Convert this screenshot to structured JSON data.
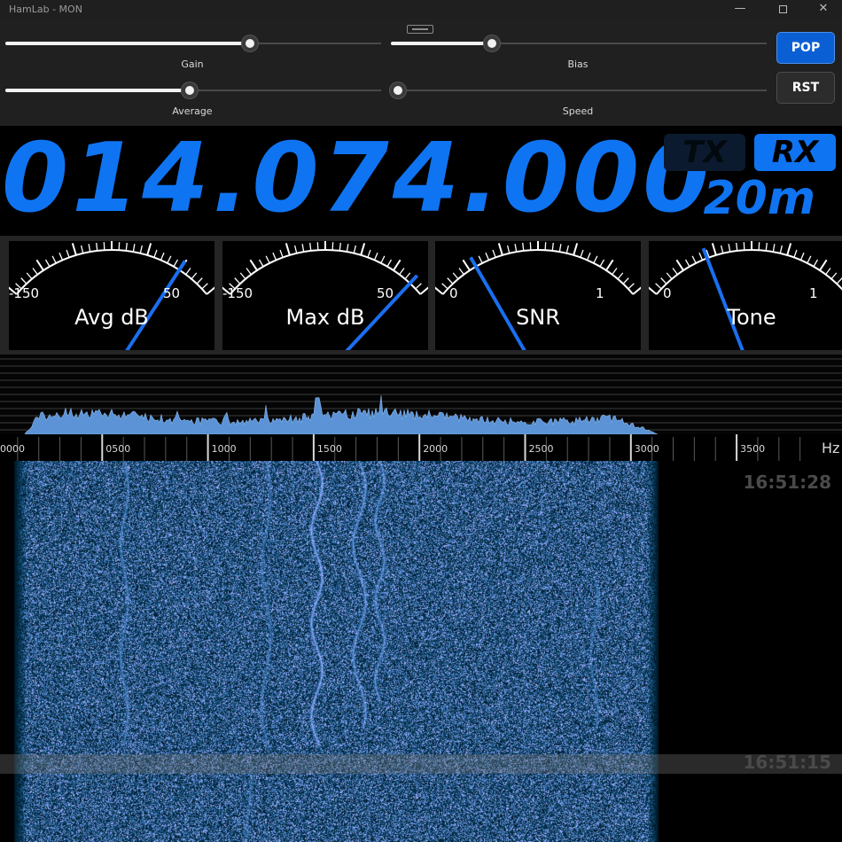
{
  "window": {
    "title": "HamLab - MON",
    "minimize_glyph": "—",
    "close_glyph": "✕"
  },
  "controls": {
    "sliders": [
      {
        "name": "gain",
        "label": "Gain",
        "value": 0.65
      },
      {
        "name": "bias",
        "label": "Bias",
        "value": 0.27
      },
      {
        "name": "average",
        "label": "Average",
        "value": 0.49
      },
      {
        "name": "speed",
        "label": "Speed",
        "value": 0.02
      }
    ],
    "pop_label": "POP",
    "rst_label": "RST"
  },
  "display": {
    "frequency": "014.074.000",
    "tx_label": "TX",
    "rx_label": "RX",
    "band": "20m",
    "colors": {
      "accent": "#0f74f2",
      "tx_off": "#0b1a2e"
    }
  },
  "meters": [
    {
      "label": "Avg dB",
      "min": "-150",
      "max": "50",
      "value": 0.83
    },
    {
      "label": "Max dB",
      "min": "-150",
      "max": "50",
      "value": 0.93
    },
    {
      "label": "SNR",
      "min": "0",
      "max": "1",
      "value": 0.2
    },
    {
      "label": "Tone",
      "min": "0",
      "max": "1",
      "value": 0.29
    }
  ],
  "spectrum": {
    "unit": "Hz",
    "tick_labels": [
      "0000",
      "0500",
      "1000",
      "1500",
      "2000",
      "2500",
      "3000",
      "3500"
    ]
  },
  "waterfall": {
    "timestamps": [
      "16:51:28",
      "16:51:15"
    ]
  }
}
